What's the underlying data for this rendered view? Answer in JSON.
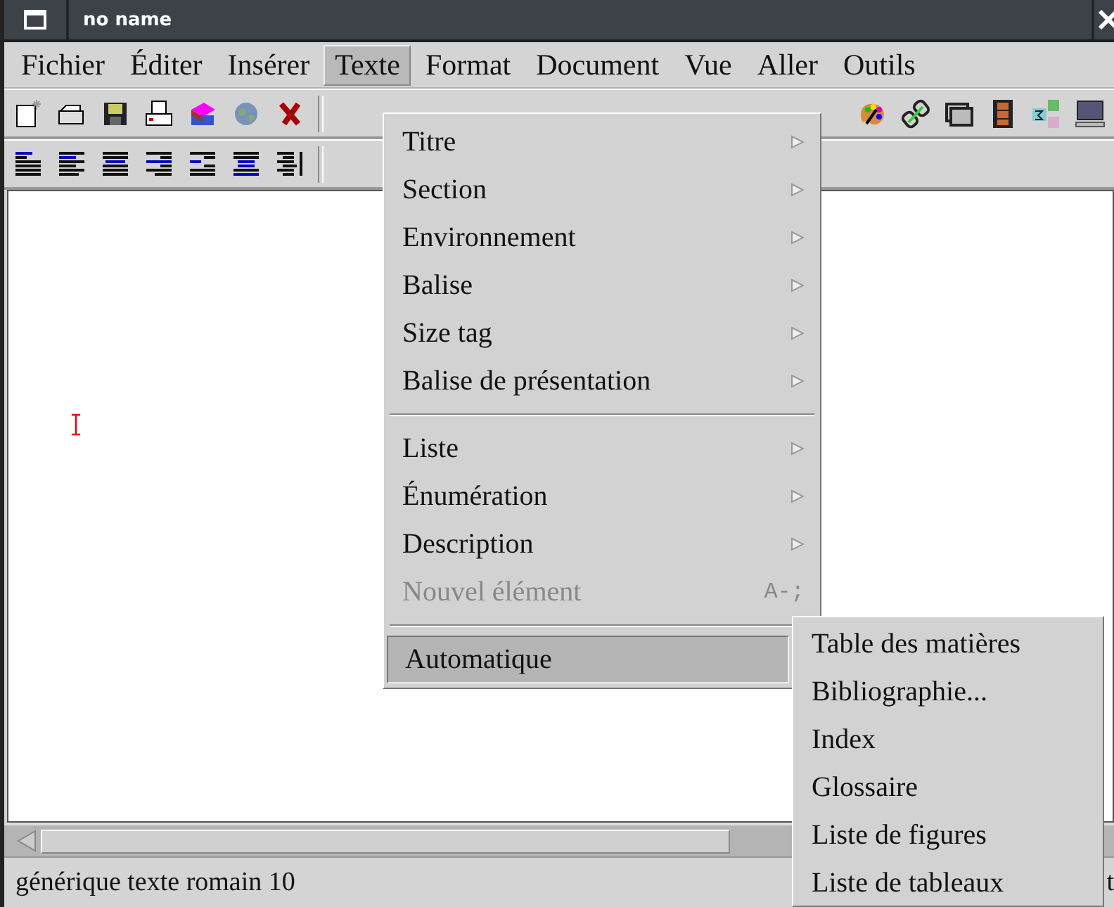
{
  "window": {
    "title": "no name"
  },
  "menubar": [
    {
      "label": "Fichier",
      "selected": false
    },
    {
      "label": "Éditer",
      "selected": false
    },
    {
      "label": "Insérer",
      "selected": false
    },
    {
      "label": "Texte",
      "selected": true
    },
    {
      "label": "Format",
      "selected": false
    },
    {
      "label": "Document",
      "selected": false
    },
    {
      "label": "Vue",
      "selected": false
    },
    {
      "label": "Aller",
      "selected": false
    },
    {
      "label": "Outils",
      "selected": false
    }
  ],
  "menu": [
    {
      "kind": "item",
      "label": "Titre",
      "submenu": true,
      "disabled": false,
      "selected": false
    },
    {
      "kind": "item",
      "label": "Section",
      "submenu": true,
      "disabled": false,
      "selected": false
    },
    {
      "kind": "item",
      "label": "Environnement",
      "submenu": true,
      "disabled": false,
      "selected": false
    },
    {
      "kind": "item",
      "label": "Balise",
      "submenu": true,
      "disabled": false,
      "selected": false
    },
    {
      "kind": "item",
      "label": "Size tag",
      "submenu": true,
      "disabled": false,
      "selected": false
    },
    {
      "kind": "item",
      "label": "Balise de présentation",
      "submenu": true,
      "disabled": false,
      "selected": false
    },
    {
      "kind": "separator"
    },
    {
      "kind": "item",
      "label": "Liste",
      "submenu": true,
      "disabled": false,
      "selected": false
    },
    {
      "kind": "item",
      "label": "Énumération",
      "submenu": true,
      "disabled": false,
      "selected": false
    },
    {
      "kind": "item",
      "label": "Description",
      "submenu": true,
      "disabled": false,
      "selected": false
    },
    {
      "kind": "item",
      "label": "Nouvel élément",
      "submenu": false,
      "disabled": true,
      "shortcut": "A-;",
      "selected": false
    },
    {
      "kind": "separator"
    },
    {
      "kind": "item",
      "label": "Automatique",
      "submenu": false,
      "disabled": false,
      "selected": true
    }
  ],
  "submenu": [
    "Table des matières",
    "Bibliographie...",
    "Index",
    "Glossaire",
    "Liste de figures",
    "Liste de tableaux"
  ],
  "status_bar": {
    "text": "générique texte romain 10",
    "right_text": "t"
  }
}
